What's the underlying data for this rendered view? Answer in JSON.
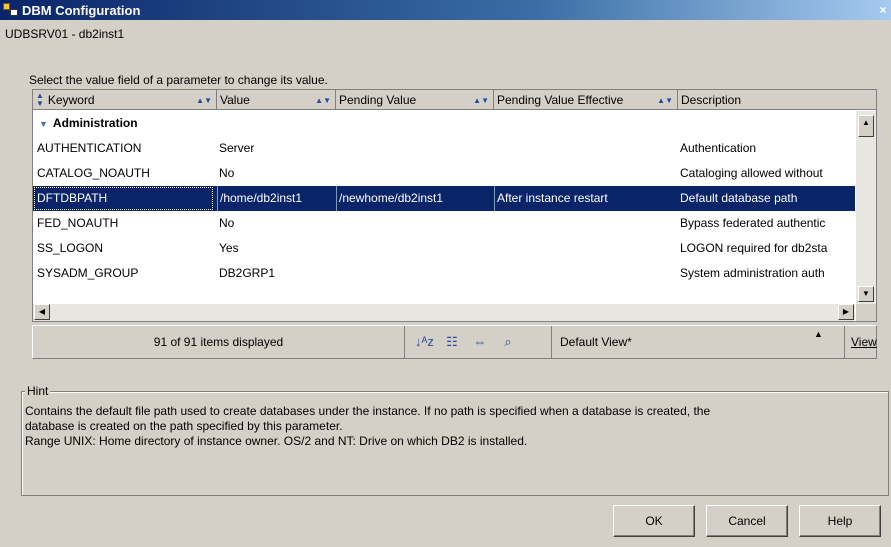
{
  "window": {
    "title": "DBM Configuration",
    "close_label": "×"
  },
  "instance": "UDBSRV01 - db2inst1",
  "instruction": "Select the value field of a parameter to change its value.",
  "table": {
    "columns": [
      "Keyword",
      "Value",
      "Pending Value",
      "Pending Value Effective",
      "Description"
    ],
    "group": "Administration",
    "rows": [
      {
        "keyword": "AUTHENTICATION",
        "value": "Server",
        "pending": "",
        "effective": "",
        "description": "Authentication"
      },
      {
        "keyword": "CATALOG_NOAUTH",
        "value": "No",
        "pending": "",
        "effective": "",
        "description": "Cataloging allowed without"
      },
      {
        "keyword": "DFTDBPATH",
        "value": "/home/db2inst1",
        "pending": "/newhome/db2inst1",
        "effective": "After instance restart",
        "description": "Default database path"
      },
      {
        "keyword": "FED_NOAUTH",
        "value": "No",
        "pending": "",
        "effective": "",
        "description": "Bypass federated authentic"
      },
      {
        "keyword": "SS_LOGON",
        "value": "Yes",
        "pending": "",
        "effective": "",
        "description": "LOGON required for db2sta"
      },
      {
        "keyword": "SYSADM_GROUP",
        "value": "DB2GRP1",
        "pending": "",
        "effective": "",
        "description": "System administration auth"
      }
    ],
    "selected_row": 2
  },
  "status": {
    "count": "91 of 91 items displayed",
    "view_name": "Default View*",
    "view_button": "View"
  },
  "toolbar_icons": [
    "sort-icon",
    "filter-icon",
    "customize-columns-icon",
    "find-icon"
  ],
  "hint": {
    "title": "Hint",
    "line1": "Contains the default file path used to create databases under the instance. If no path is specified when a database is created, the",
    "line2": "database is created on the path specified by this parameter.",
    "line3": "Range UNIX: Home directory of instance owner. OS/2 and NT: Drive on which DB2 is installed."
  },
  "buttons": {
    "ok": "OK",
    "cancel": "Cancel",
    "help": "Help"
  },
  "colors": {
    "selection": "#0a246a",
    "dialog_bg": "#d4d0c8"
  }
}
